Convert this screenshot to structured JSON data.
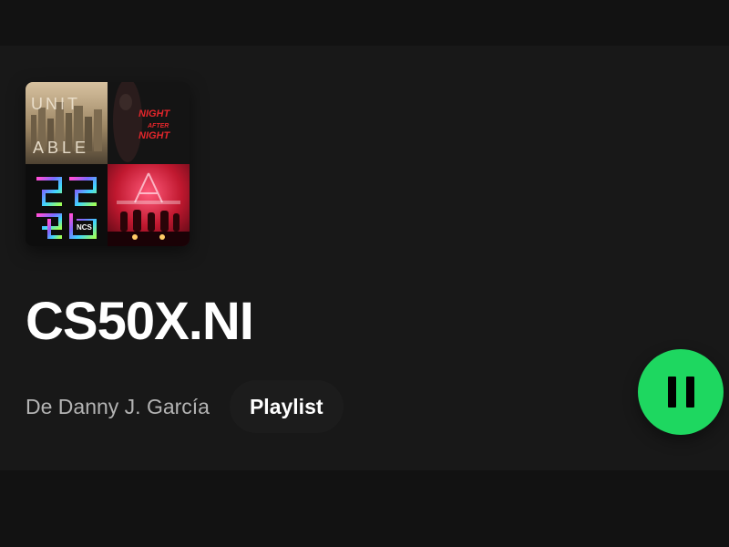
{
  "playlist": {
    "title": "CS50X.NI",
    "owner_line": "De Danny J. García",
    "type_label": "Playlist",
    "is_playing": true
  },
  "cover_tiles": [
    {
      "name": "album-cover-unitable",
      "text_lines": [
        "UNIT",
        "ABLE"
      ],
      "accent": "#a8875a"
    },
    {
      "name": "album-cover-night-after-night",
      "text_lines": [
        "NIGHT",
        "AFTER",
        "NIGHT"
      ],
      "accent": "#e3262b"
    },
    {
      "name": "album-cover-ncs",
      "text_lines": [
        "NCS"
      ],
      "accent": "#e35cff"
    },
    {
      "name": "album-cover-axwell-ingrosso",
      "text_lines": [],
      "accent": "#ff2a5c"
    }
  ],
  "colors": {
    "background": "#121212",
    "card": "#181818",
    "accent_green": "#1ed760",
    "text_primary": "#ffffff",
    "text_secondary": "#b3b3b3"
  },
  "icons": {
    "play_button": "pause-icon"
  }
}
